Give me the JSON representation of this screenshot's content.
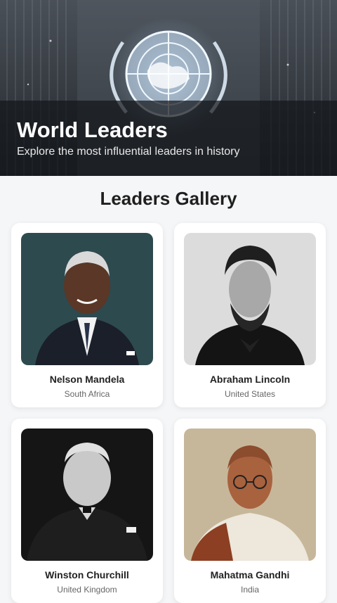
{
  "hero": {
    "title": "World Leaders",
    "subtitle": "Explore the most influential leaders in history"
  },
  "gallery": {
    "title": "Leaders Gallery",
    "leaders": [
      {
        "name": "Nelson Mandela",
        "country": "South Africa"
      },
      {
        "name": "Abraham Lincoln",
        "country": "United States"
      },
      {
        "name": "Winston Churchill",
        "country": "United Kingdom"
      },
      {
        "name": "Mahatma Gandhi",
        "country": "India"
      }
    ]
  },
  "colors": {
    "page_bg": "#f5f6f8",
    "card_bg": "#ffffff",
    "hero_overlay": "#14161a"
  }
}
